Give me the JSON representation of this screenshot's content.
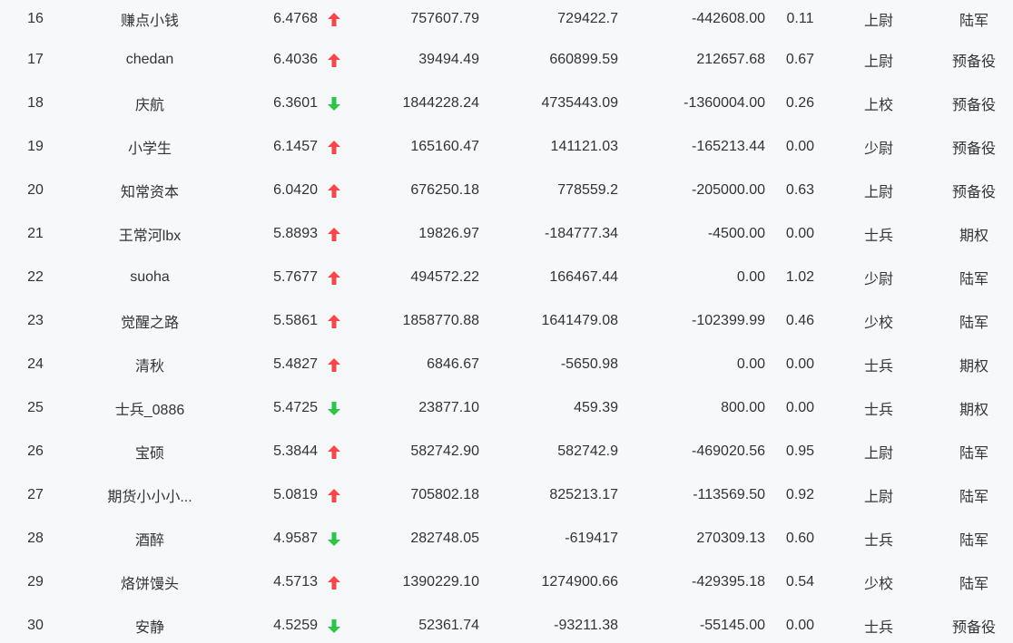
{
  "colors": {
    "background": "#f7f8fa",
    "text": "#333333",
    "up": "#f5484a",
    "down": "#2ec447"
  },
  "icons": {
    "up": "arrow-up-icon",
    "down": "arrow-down-icon"
  },
  "rows": [
    {
      "rank": "16",
      "name": "赚点小钱",
      "score": "6.4768",
      "trend": "up",
      "v1": "757607.79",
      "v2": "729422.7",
      "v3": "-442608.00",
      "ratio": "0.11",
      "level": "上尉",
      "category": "陆军"
    },
    {
      "rank": "17",
      "name": "chedan",
      "score": "6.4036",
      "trend": "up",
      "v1": "39494.49",
      "v2": "660899.59",
      "v3": "212657.68",
      "ratio": "0.67",
      "level": "上尉",
      "category": "预备役"
    },
    {
      "rank": "18",
      "name": "庆航",
      "score": "6.3601",
      "trend": "down",
      "v1": "1844228.24",
      "v2": "4735443.09",
      "v3": "-1360004.00",
      "ratio": "0.26",
      "level": "上校",
      "category": "预备役"
    },
    {
      "rank": "19",
      "name": "小学生",
      "score": "6.1457",
      "trend": "up",
      "v1": "165160.47",
      "v2": "141121.03",
      "v3": "-165213.44",
      "ratio": "0.00",
      "level": "少尉",
      "category": "预备役"
    },
    {
      "rank": "20",
      "name": "知常资本",
      "score": "6.0420",
      "trend": "up",
      "v1": "676250.18",
      "v2": "778559.2",
      "v3": "-205000.00",
      "ratio": "0.63",
      "level": "上尉",
      "category": "预备役"
    },
    {
      "rank": "21",
      "name": "王常河lbx",
      "score": "5.8893",
      "trend": "up",
      "v1": "19826.97",
      "v2": "-184777.34",
      "v3": "-4500.00",
      "ratio": "0.00",
      "level": "士兵",
      "category": "期权"
    },
    {
      "rank": "22",
      "name": "suoha",
      "score": "5.7677",
      "trend": "up",
      "v1": "494572.22",
      "v2": "166467.44",
      "v3": "0.00",
      "ratio": "1.02",
      "level": "少尉",
      "category": "陆军"
    },
    {
      "rank": "23",
      "name": "觉醒之路",
      "score": "5.5861",
      "trend": "up",
      "v1": "1858770.88",
      "v2": "1641479.08",
      "v3": "-102399.99",
      "ratio": "0.46",
      "level": "少校",
      "category": "陆军"
    },
    {
      "rank": "24",
      "name": "清秋",
      "score": "5.4827",
      "trend": "up",
      "v1": "6846.67",
      "v2": "-5650.98",
      "v3": "0.00",
      "ratio": "0.00",
      "level": "士兵",
      "category": "期权"
    },
    {
      "rank": "25",
      "name": "士兵_0886",
      "score": "5.4725",
      "trend": "down",
      "v1": "23877.10",
      "v2": "459.39",
      "v3": "800.00",
      "ratio": "0.00",
      "level": "士兵",
      "category": "期权"
    },
    {
      "rank": "26",
      "name": "宝硕",
      "score": "5.3844",
      "trend": "up",
      "v1": "582742.90",
      "v2": "582742.9",
      "v3": "-469020.56",
      "ratio": "0.95",
      "level": "上尉",
      "category": "陆军"
    },
    {
      "rank": "27",
      "name": "期货小小小...",
      "score": "5.0819",
      "trend": "up",
      "v1": "705802.18",
      "v2": "825213.17",
      "v3": "-113569.50",
      "ratio": "0.92",
      "level": "上尉",
      "category": "陆军"
    },
    {
      "rank": "28",
      "name": "酒醉",
      "score": "4.9587",
      "trend": "down",
      "v1": "282748.05",
      "v2": "-619417",
      "v3": "270309.13",
      "ratio": "0.60",
      "level": "士兵",
      "category": "陆军"
    },
    {
      "rank": "29",
      "name": "烙饼馒头",
      "score": "4.5713",
      "trend": "up",
      "v1": "1390229.10",
      "v2": "1274900.66",
      "v3": "-429395.18",
      "ratio": "0.54",
      "level": "少校",
      "category": "陆军"
    },
    {
      "rank": "30",
      "name": "安静",
      "score": "4.5259",
      "trend": "down",
      "v1": "52361.74",
      "v2": "-93211.38",
      "v3": "-55145.00",
      "ratio": "0.00",
      "level": "士兵",
      "category": "预备役"
    }
  ]
}
